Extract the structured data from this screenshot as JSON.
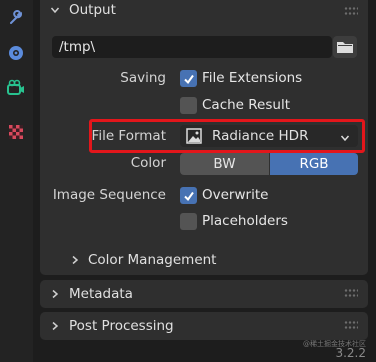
{
  "toolbar": {
    "icons": [
      "wrench-icon",
      "physics-icon",
      "output-camera-icon",
      "texture-checker-icon"
    ]
  },
  "output_panel": {
    "title": "Output",
    "path_value": "/tmp\\",
    "saving": {
      "label": "Saving",
      "file_extensions": {
        "label": "File Extensions",
        "checked": true
      },
      "cache_result": {
        "label": "Cache Result",
        "checked": false
      }
    },
    "file_format": {
      "label": "File Format",
      "selected": "Radiance HDR"
    },
    "color": {
      "label": "Color",
      "options": [
        "BW",
        "RGB"
      ],
      "selected": "RGB"
    },
    "image_sequence": {
      "label": "Image Sequence",
      "overwrite": {
        "label": "Overwrite",
        "checked": true
      },
      "placeholders": {
        "label": "Placeholders",
        "checked": false
      }
    },
    "color_management": {
      "label": "Color Management"
    }
  },
  "metadata_panel": {
    "title": "Metadata"
  },
  "post_processing_panel": {
    "title": "Post Processing"
  },
  "watermark": "@稀土掘金技术社区",
  "version": "3.2.2",
  "colors": {
    "accent": "#4772b3",
    "highlight": "#e3161b",
    "panel": "#2f2f2f",
    "background": "#1d1d1d"
  }
}
